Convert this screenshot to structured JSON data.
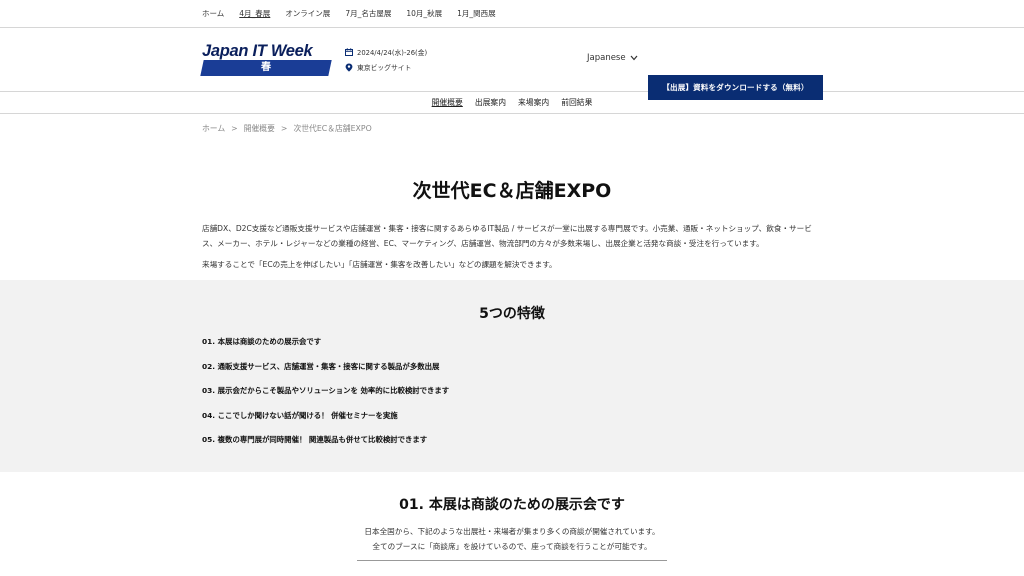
{
  "topnav": {
    "items": [
      "ホーム",
      "4月_春展",
      "オンライン展",
      "7月_名古屋展",
      "10月_秋展",
      "1月_関西展"
    ]
  },
  "header": {
    "logo_text": "Japan IT Week",
    "logo_season": "春",
    "event_date": "2024/4/24(水)-26(金)",
    "event_venue": "東京ビッグサイト",
    "language": "Japanese",
    "download_label": "【出展】資料をダウンロードする（無料）"
  },
  "subnav": {
    "items": [
      "開催概要",
      "出展案内",
      "来場案内",
      "前回結果"
    ]
  },
  "breadcrumb": {
    "items": [
      "ホーム",
      "開催概要",
      "次世代EC＆店舗EXPO"
    ],
    "separator": ">"
  },
  "page": {
    "title": "次世代EC＆店舗EXPO",
    "intro_1": "店舗DX、D2C支援など通販支援サービスや店舗運営・集客・接客に関するあらゆるIT製品 / サービスが一堂に出展する専門展です。小売業、通販・ネットショップ、飲食・サービス、メーカー、ホテル・レジャーなどの業種の経営、EC、マーケティング、店舗運営、物流部門の方々が多数来場し、出展企業と活発な商談・受注を行っています。",
    "intro_2": "来場することで「ECの売上を伸ばしたい」「店舗運営・集客を改善したい」などの課題を解決できます。"
  },
  "features": {
    "title": "5つの特徴",
    "items": [
      "01. 本展は商談のための展示会です",
      "02. 通販支援サービス、店舗運営・集客・接客に関する製品が多数出展",
      "03. 展示会だからこそ製品やソリューションを 効率的に比較検討できます",
      "04. ここでしか聞けない話が聞ける！ 併催セミナーを実施",
      "05. 複数の専門展が同時開催！ 関連製品も併せて比較検討できます"
    ]
  },
  "section1": {
    "title": "01. 本展は商談のための展示会です",
    "desc_1": "日本全国から、下記のような出展社・来場者が集まり多くの商談が開催されています。",
    "desc_2": "全てのブースに「商談席」を設けているので、座って商談を行うことが可能です。"
  },
  "colors": {
    "brand_navy": "#0a2d73",
    "logo_blue": "#1a3d96",
    "feature_bg": "#f2f2f2"
  }
}
